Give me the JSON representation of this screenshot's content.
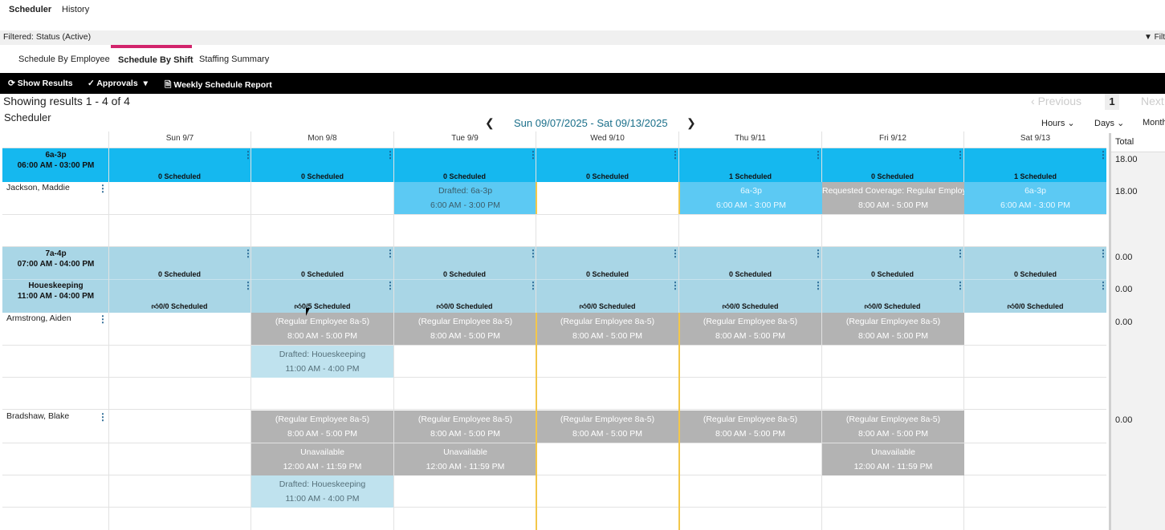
{
  "topnav": {
    "tab_scheduler": "Scheduler",
    "tab_history": "History"
  },
  "filter": {
    "text": "Filtered: Status (Active)",
    "right_label": "Filt"
  },
  "subtabs": {
    "by_employee": "Schedule By Employee",
    "by_shift": "Schedule By Shift",
    "staffing": "Staffing Summary"
  },
  "toolbar": {
    "show_results": "Show Results",
    "approvals": "Approvals",
    "weekly_report": "Weekly Schedule Report"
  },
  "results_text": "Showing results 1 - 4 of 4",
  "scheduler_label": "Scheduler",
  "pager": {
    "previous": "Previous",
    "page": "1",
    "next": "Next"
  },
  "date_range": "Sun 09/07/2025 - Sat 09/13/2025",
  "view": {
    "hours": "Hours",
    "days": "Days",
    "month": "Month"
  },
  "days": [
    "Sun 9/7",
    "Mon 9/8",
    "Tue 9/9",
    "Wed 9/10",
    "Thu 9/11",
    "Fri 9/12",
    "Sat 9/13"
  ],
  "shifts": {
    "a": {
      "name": "6a-3p",
      "time": "06:00 AM - 03:00 PM",
      "counts": [
        "0 Scheduled",
        "0 Scheduled",
        "0 Scheduled",
        "0 Scheduled",
        "1 Scheduled",
        "0 Scheduled",
        "1 Scheduled"
      ]
    },
    "b": {
      "name": "7a-4p",
      "time": "07:00 AM - 04:00 PM",
      "counts": [
        "0 Scheduled",
        "0 Scheduled",
        "0 Scheduled",
        "0 Scheduled",
        "0 Scheduled",
        "0 Scheduled",
        "0 Scheduled"
      ]
    },
    "c": {
      "name": "Houeskeeping",
      "time": "11:00 AM - 04:00 PM",
      "counts": [
        "0/0 Scheduled",
        "0/5 Scheduled",
        "0/0 Scheduled",
        "0/0 Scheduled",
        "0/0 Scheduled",
        "0/0 Scheduled",
        "0/0 Scheduled"
      ]
    }
  },
  "employees": {
    "jackson": "Jackson, Maddie",
    "armstrong": "Armstrong, Aiden",
    "bradshaw": "Bradshaw, Blake"
  },
  "blocks": {
    "drafted_6a": {
      "l1": "Drafted: 6a-3p",
      "l2": "6:00 AM - 3:00 PM"
    },
    "shift_6a": {
      "l1": "6a-3p",
      "l2": "6:00 AM - 3:00 PM"
    },
    "req_cov": {
      "l1": "Requested Coverage: Regular Employ",
      "l2": "8:00 AM - 5:00 PM"
    },
    "reg": {
      "l1": "(Regular Employee 8a-5)",
      "l2": "8:00 AM - 5:00 PM"
    },
    "drafted_hk": {
      "l1": "Drafted: Houeskeeping",
      "l2": "11:00 AM - 4:00 PM"
    },
    "unavail": {
      "l1": "Unavailable",
      "l2": "12:00 AM - 11:59 PM"
    }
  },
  "totals": {
    "header": "Total",
    "values": [
      "18.00",
      "18.00",
      "0.00",
      "0.00",
      "0.00",
      "0.00"
    ]
  },
  "colors": {
    "shift_blue": "#15b8ef",
    "light_blue": "#a9d6e6",
    "gray_block": "#b3b3b3",
    "accent_pink": "#d2246c",
    "today_line": "#f3c74a"
  }
}
